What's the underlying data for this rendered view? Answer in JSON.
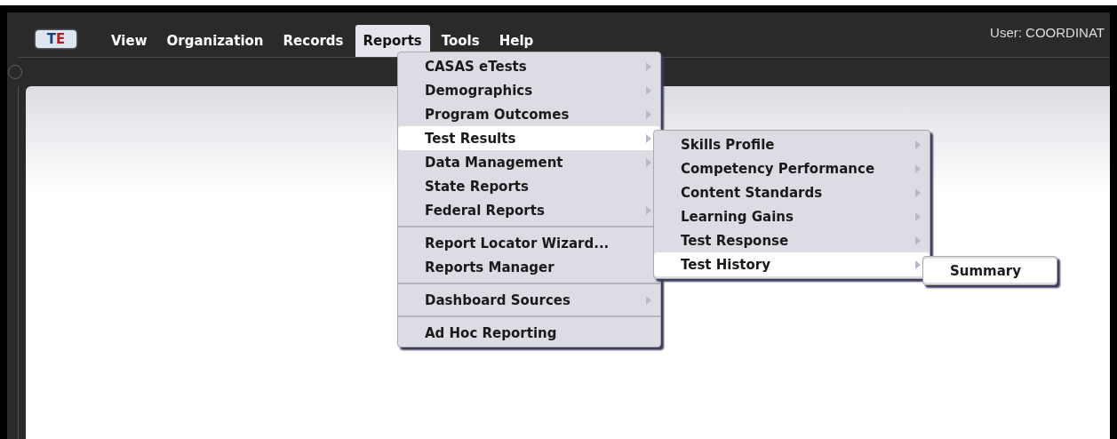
{
  "logo": {
    "text": "TE"
  },
  "menubar": [
    {
      "label": "View",
      "selected": false
    },
    {
      "label": "Organization",
      "selected": false
    },
    {
      "label": "Records",
      "selected": false
    },
    {
      "label": "Reports",
      "selected": true
    },
    {
      "label": "Tools",
      "selected": false
    },
    {
      "label": "Help",
      "selected": false
    }
  ],
  "user": "User: COORDINAT",
  "reports_menu": {
    "groups": [
      [
        {
          "label": "CASAS eTests",
          "has_submenu": true,
          "selected": false
        },
        {
          "label": "Demographics",
          "has_submenu": true,
          "selected": false
        },
        {
          "label": "Program Outcomes",
          "has_submenu": true,
          "selected": false
        },
        {
          "label": "Test Results",
          "has_submenu": true,
          "selected": true
        },
        {
          "label": "Data Management",
          "has_submenu": true,
          "selected": false
        },
        {
          "label": "State Reports",
          "has_submenu": false,
          "selected": false
        },
        {
          "label": "Federal Reports",
          "has_submenu": true,
          "selected": false
        }
      ],
      [
        {
          "label": "Report Locator Wizard...",
          "has_submenu": false,
          "selected": false
        },
        {
          "label": "Reports Manager",
          "has_submenu": false,
          "selected": false
        }
      ],
      [
        {
          "label": "Dashboard Sources",
          "has_submenu": true,
          "selected": false
        }
      ],
      [
        {
          "label": "Ad Hoc Reporting",
          "has_submenu": false,
          "selected": false
        }
      ]
    ]
  },
  "test_results_menu": {
    "items": [
      {
        "label": "Skills Profile",
        "has_submenu": true,
        "selected": false
      },
      {
        "label": "Competency Performance",
        "has_submenu": true,
        "selected": false
      },
      {
        "label": "Content Standards",
        "has_submenu": true,
        "selected": false
      },
      {
        "label": "Learning Gains",
        "has_submenu": true,
        "selected": false
      },
      {
        "label": "Test Response",
        "has_submenu": true,
        "selected": false
      },
      {
        "label": "Test History",
        "has_submenu": true,
        "selected": true
      }
    ]
  },
  "test_history_menu": {
    "items": [
      {
        "label": "Summary",
        "has_submenu": false,
        "selected": true
      }
    ]
  }
}
